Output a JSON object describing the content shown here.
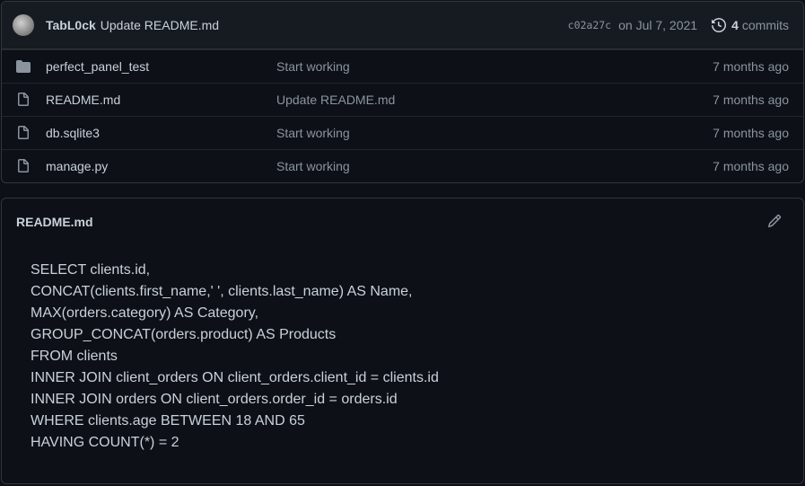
{
  "commit": {
    "author": "TabL0ck",
    "message": "Update README.md",
    "sha": "c02a27c",
    "date": "on Jul 7, 2021",
    "count": "4",
    "count_label": "commits"
  },
  "files": [
    {
      "type": "directory",
      "name": "perfect_panel_test",
      "commit": "Start working",
      "age": "7 months ago"
    },
    {
      "type": "file",
      "name": "README.md",
      "commit": "Update README.md",
      "age": "7 months ago"
    },
    {
      "type": "file",
      "name": "db.sqlite3",
      "commit": "Start working",
      "age": "7 months ago"
    },
    {
      "type": "file",
      "name": "manage.py",
      "commit": "Start working",
      "age": "7 months ago"
    }
  ],
  "readme": {
    "title": "README.md",
    "lines": [
      "SELECT clients.id,",
      "CONCAT(clients.first_name,' ', clients.last_name) AS Name,",
      "MAX(orders.category) AS Category,",
      "GROUP_CONCAT(orders.product) AS Products",
      "FROM clients",
      "INNER JOIN client_orders ON client_orders.client_id = clients.id",
      "INNER JOIN orders ON client_orders.order_id = orders.id",
      "WHERE clients.age BETWEEN 18 AND 65",
      "HAVING COUNT(*) = 2"
    ]
  },
  "colors": {
    "background": "#0d1117",
    "header_bg": "#161b22",
    "border": "#30363d",
    "text": "#c9d1d9",
    "muted": "#8b949e"
  }
}
